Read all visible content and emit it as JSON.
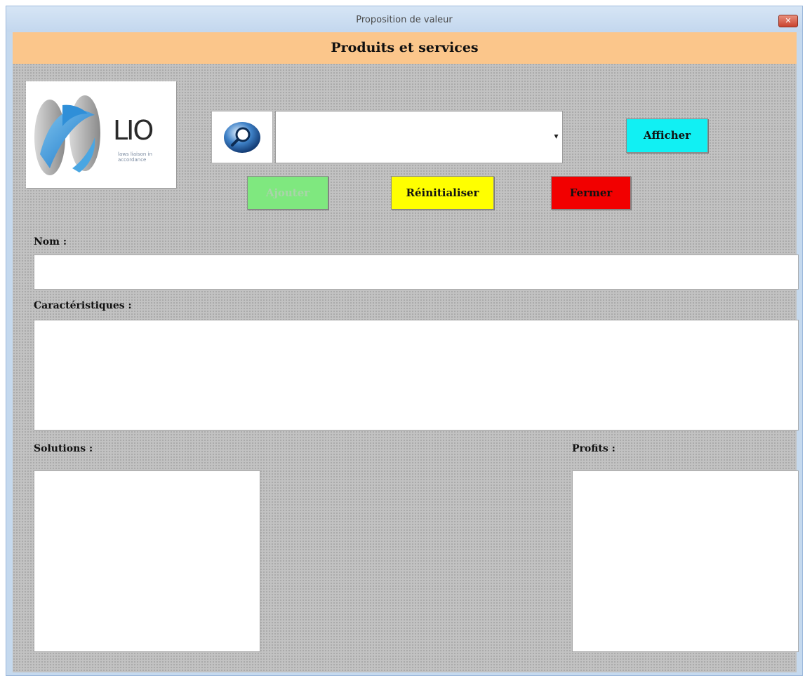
{
  "window": {
    "title": "Proposition de valeur",
    "close_glyph": "✕"
  },
  "header": {
    "title": "Produits et services",
    "band_color": "#fbc68b"
  },
  "logo": {
    "brand": "LIO",
    "tagline": "laws liaison in accordance",
    "icon": "lio-logo-icon"
  },
  "search": {
    "icon": "magnifier-icon",
    "combo_value": "",
    "dropdown_icon": "dropdown-arrow-icon"
  },
  "buttons": {
    "afficher": "Afficher",
    "ajouter": "Ajouter",
    "reinitialiser": "Réinitialiser",
    "fermer": "Fermer"
  },
  "colors": {
    "afficher": "#11f0f3",
    "ajouter": "#7fe87f",
    "reinitialiser": "#ffff00",
    "fermer": "#f20000"
  },
  "form": {
    "nom_label": "Nom :",
    "nom_value": "",
    "caracteristiques_label": "Caractéristiques :",
    "caracteristiques_value": "",
    "solutions_label": "Solutions :",
    "solutions_value": "",
    "profits_label": "Profits :",
    "profits_value": ""
  }
}
